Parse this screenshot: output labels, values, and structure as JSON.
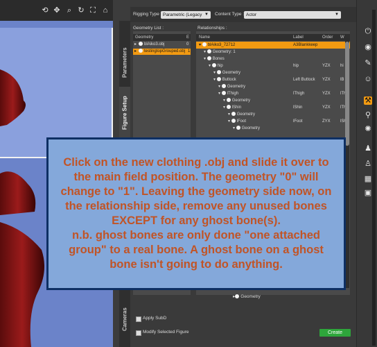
{
  "toolbar": {
    "icons": [
      "camera-orbit-icon",
      "pan-icon",
      "zoom-icon",
      "rotate-icon",
      "frame-icon",
      "home-icon"
    ]
  },
  "side_tabs": {
    "parameters": "Parameters",
    "figure_setup": "Figure Setup",
    "cameras": "Cameras"
  },
  "rigging_type": {
    "label": "Rigging Type :",
    "value": "Parametric (Legacy"
  },
  "content_type": {
    "label": "Content Type :",
    "value": "Actor"
  },
  "geometry_list": {
    "title": "Geometry List :",
    "headers": {
      "name": "Geometry",
      "e": "E"
    },
    "rows": [
      {
        "name": "blAiko3.obj",
        "e": "0"
      },
      {
        "name": "testingtopGrouped.obj",
        "e": "1"
      }
    ]
  },
  "relationships": {
    "title": "Relationships :",
    "headers": {
      "name": "Name",
      "label": "Label",
      "order": "Order",
      "w": "W"
    },
    "rows": [
      {
        "name": "blAiko3_72712",
        "label": "A3Blankkeep",
        "order": "",
        "w": "",
        "indent": 0
      },
      {
        "name": "Geometry: 1",
        "label": "",
        "order": "",
        "w": "",
        "indent": 1
      },
      {
        "name": "Bones",
        "label": "",
        "order": "",
        "w": "",
        "indent": 1
      },
      {
        "name": "hip",
        "label": "hip",
        "order": "YZX",
        "w": "hi",
        "indent": 2
      },
      {
        "name": "Geometry",
        "label": "",
        "order": "",
        "w": "",
        "indent": 3
      },
      {
        "name": "Buttock",
        "label": "Left Buttock",
        "order": "YZX",
        "w": "lB",
        "indent": 3
      },
      {
        "name": "Geometry",
        "label": "",
        "order": "",
        "w": "",
        "indent": 4
      },
      {
        "name": "lThigh",
        "label": "lThigh",
        "order": "YZX",
        "w": "lTh",
        "indent": 4
      },
      {
        "name": "Geometry",
        "label": "",
        "order": "",
        "w": "",
        "indent": 5
      },
      {
        "name": "lShin",
        "label": "lShin",
        "order": "YZX",
        "w": "lTh",
        "indent": 5
      },
      {
        "name": "Geometry",
        "label": "",
        "order": "",
        "w": "",
        "indent": 6
      },
      {
        "name": "lFoot",
        "label": "lFoot",
        "order": "ZYX",
        "w": "lSh",
        "indent": 6
      },
      {
        "name": "Geometry",
        "label": "",
        "order": "",
        "w": "",
        "indent": 7
      }
    ],
    "bottom_row": {
      "name": "Geometry"
    }
  },
  "options": {
    "apply_subd": "Apply SubD",
    "modify_selected": "Modify Selected Figure"
  },
  "create_button": "Create",
  "right_bar": {
    "icons": [
      "power-icon",
      "world-icon",
      "tools-icon",
      "person-icon",
      "pose-icon",
      "figure-setup-icon",
      "morph-icon",
      "bone-icon",
      "ghost-icon",
      "lock-icon",
      "grid-icon",
      "settings-icon",
      "scene-icon"
    ]
  },
  "note": {
    "text": "Click on the new clothing .obj and slide it over to the main field position. The geometry \"0\" will change to \"1\". Leaving the geometry side now, on the relationship side, remove any unused bones EXCEPT for any ghost bone(s).\nn.b. ghost bones are only done \"one attached group\" to a real bone. A ghost bone on a ghost bone isn't going to do anything."
  },
  "colors": {
    "accent": "#f29a12",
    "note_bg": "#84a8da",
    "note_border": "#0e2f63",
    "note_text": "#c15426",
    "create": "#2ea63b",
    "viewport_bg": "#6b83c9"
  }
}
